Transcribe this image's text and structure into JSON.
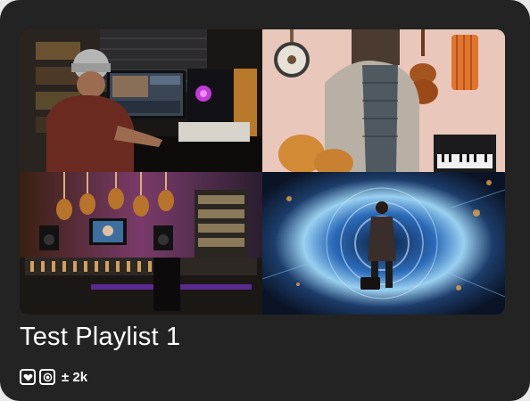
{
  "playlist": {
    "title": "Test Playlist 1",
    "play_count": "± 2k"
  },
  "thumbnails": [
    {
      "name": "thumbnail-editing-studio"
    },
    {
      "name": "thumbnail-instruments-wall"
    },
    {
      "name": "thumbnail-recording-studio"
    },
    {
      "name": "thumbnail-futuristic-portal"
    }
  ],
  "badges": [
    {
      "icon": "heart-icon"
    },
    {
      "icon": "eye-icon"
    }
  ],
  "colors": {
    "card_background": "#232323",
    "text": "#ffffff"
  }
}
